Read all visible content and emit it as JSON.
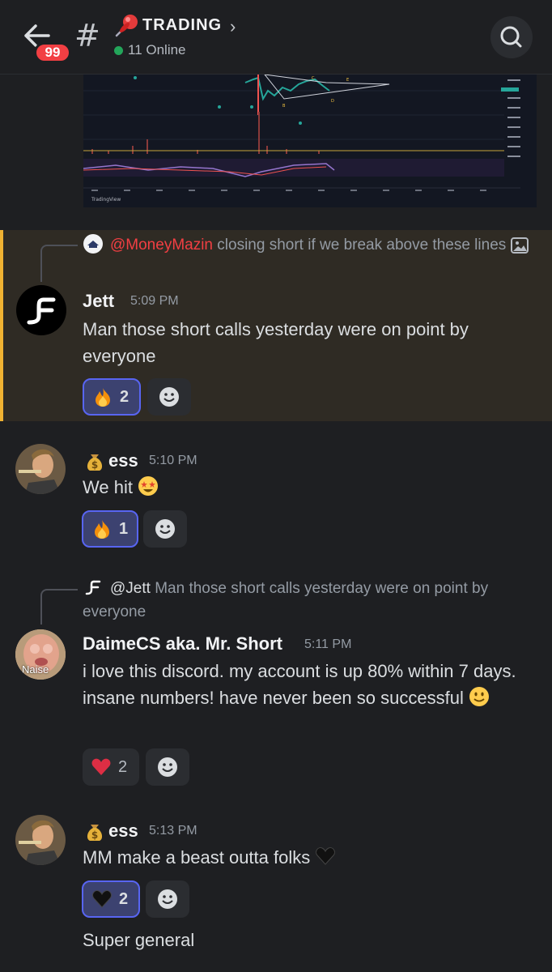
{
  "header": {
    "unread_badge": "99",
    "hash_symbol": "#",
    "channel_name": "TRADING",
    "online_text": "11 Online"
  },
  "chart_image": {
    "watermark": "TradingView"
  },
  "messages": [
    {
      "reply": {
        "author": "@MoneyMazin",
        "text": "closing short if we break above these lines"
      },
      "author": "Jett",
      "time": "5:09 PM",
      "text": "Man those short calls yesterday were on point by everyone",
      "reactions": [
        {
          "emoji": "fire",
          "count": "2",
          "me": true
        }
      ]
    },
    {
      "author": "ess",
      "time": "5:10 PM",
      "text": "We hit",
      "reactions": [
        {
          "emoji": "fire",
          "count": "1",
          "me": true
        }
      ]
    },
    {
      "reply": {
        "author": "@Jett",
        "text": "Man those short calls yesterday were on point by everyone"
      },
      "author": "DaimeCS aka. Mr. Short",
      "time": "5:11 PM",
      "avatar_text": "Naise",
      "text": "i love this discord. my account is up 80% within 7 days. insane numbers! have never been so successful",
      "reactions": [
        {
          "emoji": "red-heart",
          "count": "2",
          "me": false
        }
      ]
    },
    {
      "author": "ess",
      "time": "5:13 PM",
      "text": "MM make a beast outta folks",
      "reactions": [
        {
          "emoji": "black-heart",
          "count": "2",
          "me": true
        }
      ],
      "followup": "Super general"
    }
  ],
  "colors": {
    "accent": "#5865f2",
    "mention": "#f23f43",
    "highlight_bar": "#f0b232",
    "online": "#23a55a"
  }
}
